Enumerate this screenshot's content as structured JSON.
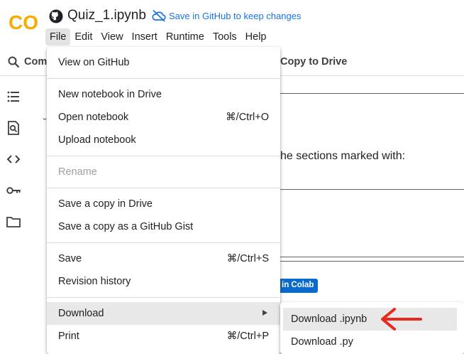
{
  "app": {
    "logo_text": "CO",
    "notebook_title": "Quiz_1.ipynb",
    "save_github": "Save in GitHub to keep changes",
    "brand_orange": "#f9ab00",
    "brand_orange_dark": "#e8710a"
  },
  "menubar": {
    "items": [
      "File",
      "Edit",
      "View",
      "Insert",
      "Runtime",
      "Tools",
      "Help"
    ],
    "active": "File"
  },
  "toolbar": {
    "commands_label": "Comm",
    "copy_to_drive": "Copy to Drive"
  },
  "rail": {
    "icons": [
      "toc-icon",
      "find-icon",
      "code-icon",
      "key-icon",
      "folder-icon"
    ]
  },
  "notebook_bg": {
    "text": "he sections marked with:",
    "badge": "in Colab",
    "badge_color": "#0b6bcb"
  },
  "file_menu": {
    "view_github": "View on GitHub",
    "new_notebook": "New notebook in Drive",
    "open_notebook": "Open notebook",
    "open_shortcut": "⌘/Ctrl+O",
    "upload_notebook": "Upload notebook",
    "rename": "Rename",
    "save_copy_drive": "Save a copy in Drive",
    "save_copy_gist": "Save a copy as a GitHub Gist",
    "save": "Save",
    "save_shortcut": "⌘/Ctrl+S",
    "revision_history": "Revision history",
    "download": "Download",
    "print": "Print",
    "print_shortcut": "⌘/Ctrl+P"
  },
  "download_submenu": {
    "ipynb": "Download .ipynb",
    "py": "Download .py"
  },
  "annotation": {
    "arrow_color": "#e8291c"
  }
}
